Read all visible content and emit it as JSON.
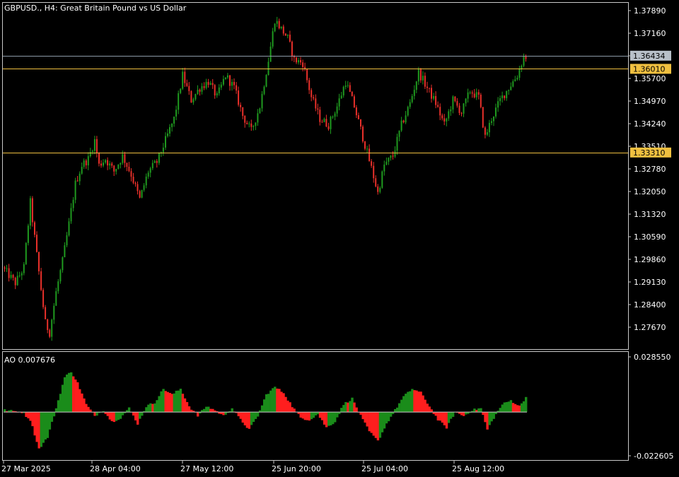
{
  "header": {
    "symbol_label": "GBPUSD., H4:  Great Britain Pound vs US Dollar"
  },
  "colors": {
    "background": "#000000",
    "frame": "#c8c8c8",
    "bull": "#1f9a1f",
    "bear": "#e8302a",
    "h_line_gray": "#8d9aa8",
    "h_line_gold": "#f0c040",
    "ao_up": "#1a8c1a",
    "ao_down": "#ff1e1e"
  },
  "chart_data": [
    {
      "type": "candlestick",
      "title": "GBPUSD., H4:  Great Britain Pound vs US Dollar",
      "ylim": [
        1.27,
        1.382
      ],
      "y_ticks": [
        "1.37890",
        "1.37160",
        "1.36430",
        "1.35700",
        "1.34970",
        "1.34240",
        "1.33510",
        "1.32780",
        "1.32050",
        "1.31320",
        "1.30590",
        "1.29860",
        "1.29130",
        "1.28400",
        "1.27670"
      ],
      "price_labels": [
        {
          "value": "1.36434",
          "kind": "current"
        },
        {
          "value": "1.36010",
          "kind": "level"
        },
        {
          "value": "1.33310",
          "kind": "level"
        }
      ],
      "trend_path": [
        [
          0,
          1.296
        ],
        [
          6,
          1.291
        ],
        [
          10,
          1.296
        ],
        [
          13,
          1.317
        ],
        [
          16,
          1.3
        ],
        [
          20,
          1.278
        ],
        [
          22,
          1.275
        ],
        [
          25,
          1.288
        ],
        [
          28,
          1.298
        ],
        [
          31,
          1.31
        ],
        [
          34,
          1.323
        ],
        [
          37,
          1.329
        ],
        [
          40,
          1.331
        ],
        [
          43,
          1.337
        ],
        [
          45,
          1.329
        ],
        [
          48,
          1.331
        ],
        [
          52,
          1.327
        ],
        [
          56,
          1.332
        ],
        [
          60,
          1.326
        ],
        [
          64,
          1.318
        ],
        [
          68,
          1.327
        ],
        [
          72,
          1.33
        ],
        [
          76,
          1.337
        ],
        [
          80,
          1.344
        ],
        [
          84,
          1.358
        ],
        [
          88,
          1.35
        ],
        [
          92,
          1.354
        ],
        [
          96,
          1.356
        ],
        [
          100,
          1.351
        ],
        [
          104,
          1.358
        ],
        [
          108,
          1.354
        ],
        [
          112,
          1.345
        ],
        [
          116,
          1.34
        ],
        [
          120,
          1.348
        ],
        [
          124,
          1.363
        ],
        [
          127,
          1.376
        ],
        [
          130,
          1.373
        ],
        [
          133,
          1.37
        ],
        [
          136,
          1.363
        ],
        [
          140,
          1.362
        ],
        [
          144,
          1.351
        ],
        [
          148,
          1.344
        ],
        [
          152,
          1.342
        ],
        [
          156,
          1.348
        ],
        [
          160,
          1.356
        ],
        [
          164,
          1.348
        ],
        [
          168,
          1.338
        ],
        [
          172,
          1.328
        ],
        [
          175,
          1.32
        ],
        [
          178,
          1.329
        ],
        [
          182,
          1.332
        ],
        [
          186,
          1.342
        ],
        [
          190,
          1.349
        ],
        [
          194,
          1.359
        ],
        [
          198,
          1.354
        ],
        [
          202,
          1.349
        ],
        [
          206,
          1.342
        ],
        [
          210,
          1.35
        ],
        [
          214,
          1.346
        ],
        [
          218,
          1.353
        ],
        [
          222,
          1.351
        ],
        [
          225,
          1.338
        ],
        [
          228,
          1.344
        ],
        [
          232,
          1.35
        ],
        [
          236,
          1.354
        ],
        [
          240,
          1.358
        ],
        [
          243,
          1.364
        ]
      ],
      "n_candles": 244,
      "x_ticks": [
        "27 Mar 2025",
        "28 Apr 04:00",
        "27 May 12:00",
        "25 Jun 20:00",
        "25 Jul 04:00",
        "25 Aug 12:00"
      ]
    },
    {
      "type": "bar",
      "name": "AO",
      "value_label": "AO 0.007676",
      "ylim": [
        -0.022605,
        0.02855
      ],
      "y_ticks": [
        "0.028550",
        "-0.022605"
      ],
      "ao_path": [
        [
          0,
          0.001
        ],
        [
          8,
          0.0
        ],
        [
          12,
          -0.004
        ],
        [
          16,
          -0.019
        ],
        [
          20,
          -0.013
        ],
        [
          24,
          0.002
        ],
        [
          28,
          0.018
        ],
        [
          31,
          0.021
        ],
        [
          34,
          0.015
        ],
        [
          38,
          0.004
        ],
        [
          42,
          -0.002
        ],
        [
          46,
          0.001
        ],
        [
          50,
          -0.005
        ],
        [
          54,
          -0.003
        ],
        [
          58,
          0.002
        ],
        [
          62,
          -0.006
        ],
        [
          66,
          0.003
        ],
        [
          70,
          0.005
        ],
        [
          74,
          0.012
        ],
        [
          78,
          0.009
        ],
        [
          82,
          0.012
        ],
        [
          86,
          0.003
        ],
        [
          90,
          -0.002
        ],
        [
          94,
          0.003
        ],
        [
          98,
          0.001
        ],
        [
          102,
          -0.002
        ],
        [
          106,
          0.002
        ],
        [
          110,
          -0.004
        ],
        [
          114,
          -0.009
        ],
        [
          118,
          -0.002
        ],
        [
          122,
          0.009
        ],
        [
          126,
          0.013
        ],
        [
          130,
          0.01
        ],
        [
          134,
          0.003
        ],
        [
          138,
          -0.003
        ],
        [
          142,
          -0.004
        ],
        [
          146,
          -0.001
        ],
        [
          150,
          -0.008
        ],
        [
          154,
          -0.005
        ],
        [
          158,
          0.004
        ],
        [
          162,
          0.007
        ],
        [
          166,
          -0.002
        ],
        [
          170,
          -0.01
        ],
        [
          174,
          -0.015
        ],
        [
          178,
          -0.006
        ],
        [
          182,
          0.001
        ],
        [
          186,
          0.008
        ],
        [
          190,
          0.012
        ],
        [
          194,
          0.01
        ],
        [
          198,
          0.003
        ],
        [
          202,
          -0.004
        ],
        [
          206,
          -0.008
        ],
        [
          210,
          0.0
        ],
        [
          214,
          -0.002
        ],
        [
          218,
          0.001
        ],
        [
          222,
          0.002
        ],
        [
          225,
          -0.009
        ],
        [
          228,
          -0.003
        ],
        [
          232,
          0.004
        ],
        [
          236,
          0.006
        ],
        [
          240,
          0.003
        ],
        [
          243,
          0.007676
        ]
      ],
      "n_bars": 244
    }
  ]
}
